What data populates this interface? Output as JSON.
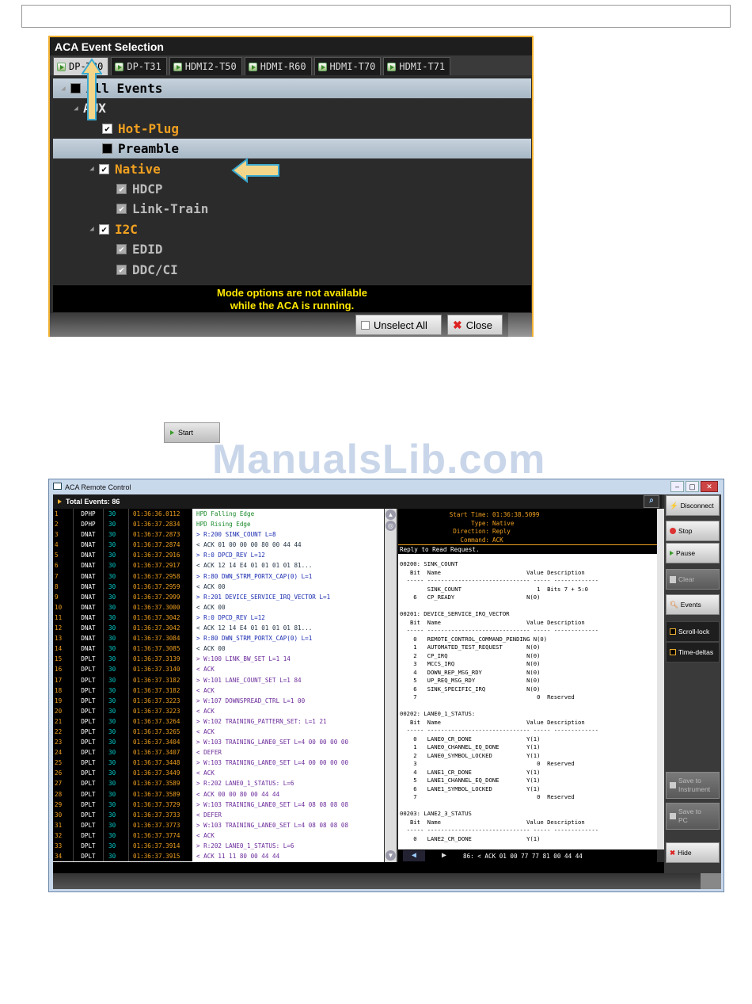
{
  "event_selection": {
    "title": "ACA Event Selection",
    "tabs": [
      "DP-T30",
      "DP-T31",
      "HDMI2-T50",
      "HDMI-R60",
      "HDMI-T70",
      "HDMI-T71"
    ],
    "selected_tab": "DP-T30",
    "tree": [
      {
        "label": "All Events",
        "check": "none",
        "style": "white",
        "highlight": true
      },
      {
        "label": "AUX",
        "check": "",
        "style": "white"
      },
      {
        "label": "Hot-Plug",
        "check": "checked",
        "style": "orange"
      },
      {
        "label": "Preamble",
        "check": "black",
        "style": "dark",
        "highlight": true
      },
      {
        "label": "Native",
        "check": "checked",
        "style": "orange"
      },
      {
        "label": "HDCP",
        "check": "grey",
        "style": "grey"
      },
      {
        "label": "Link-Train",
        "check": "grey",
        "style": "grey"
      },
      {
        "label": "I2C",
        "check": "checked",
        "style": "orange"
      },
      {
        "label": "EDID",
        "check": "grey",
        "style": "grey"
      },
      {
        "label": "DDC/CI",
        "check": "grey",
        "style": "grey"
      }
    ],
    "message_line1": "Mode options are not available",
    "message_line2": "while the ACA is running.",
    "unselect_all_label": "Unselect All",
    "close_label": "Close",
    "accent_color": "#f0b030"
  },
  "start_button": {
    "label": "Start"
  },
  "watermark": "ManualsLib.com",
  "remote_control": {
    "title": "ACA Remote Control",
    "total_events": "Total Events: 86",
    "log": [
      [
        "1",
        "DPHP",
        "30",
        "01:36:36.0112",
        "HPD Falling Edge",
        "green"
      ],
      [
        "2",
        "DPHP",
        "30",
        "01:36:37.2834",
        "HPD Rising Edge",
        "green"
      ],
      [
        "3",
        "DNAT",
        "30",
        "01:36:37.2873",
        "> R:200 SINK_COUNT L=8",
        "blue"
      ],
      [
        "4",
        "DNAT",
        "30",
        "01:36:37.2874",
        "< ACK 01 00 00 00 80 00 44 44",
        "navy"
      ],
      [
        "5",
        "DNAT",
        "30",
        "01:36:37.2916",
        "> R:0 DPCD_REV L=12",
        "blue"
      ],
      [
        "6",
        "DNAT",
        "30",
        "01:36:37.2917",
        "< ACK 12 14 E4 01 01 01 01 81...",
        "navy"
      ],
      [
        "7",
        "DNAT",
        "30",
        "01:36:37.2958",
        "> R:80 DWN_STRM_PORTX_CAP(0) L=1",
        "blue"
      ],
      [
        "8",
        "DNAT",
        "30",
        "01:36:37.2959",
        "< ACK 00",
        "navy"
      ],
      [
        "9",
        "DNAT",
        "30",
        "01:36:37.2999",
        "> R:201 DEVICE_SERVICE_IRQ_VECTOR L=1",
        "blue"
      ],
      [
        "10",
        "DNAT",
        "30",
        "01:36:37.3000",
        "< ACK 00",
        "navy"
      ],
      [
        "11",
        "DNAT",
        "30",
        "01:36:37.3042",
        "> R:0 DPCD_REV L=12",
        "blue"
      ],
      [
        "12",
        "DNAT",
        "30",
        "01:36:37.3042",
        "< ACK 12 14 E4 01 01 01 01 81...",
        "navy"
      ],
      [
        "13",
        "DNAT",
        "30",
        "01:36:37.3084",
        "> R:80 DWN_STRM_PORTX_CAP(0) L=1",
        "blue"
      ],
      [
        "14",
        "DNAT",
        "30",
        "01:36:37.3085",
        "< ACK 00",
        "navy"
      ],
      [
        "15",
        "DPLT",
        "30",
        "01:36:37.3139",
        "> W:100 LINK_BW_SET L=1 14",
        "purple"
      ],
      [
        "16",
        "DPLT",
        "30",
        "01:36:37.3140",
        "< ACK",
        "purple"
      ],
      [
        "17",
        "DPLT",
        "30",
        "01:36:37.3182",
        "> W:101 LANE_COUNT_SET L=1 84",
        "purple"
      ],
      [
        "18",
        "DPLT",
        "30",
        "01:36:37.3182",
        "< ACK",
        "purple"
      ],
      [
        "19",
        "DPLT",
        "30",
        "01:36:37.3223",
        "> W:107 DOWNSPREAD_CTRL L=1 00",
        "purple"
      ],
      [
        "20",
        "DPLT",
        "30",
        "01:36:37.3223",
        "< ACK",
        "purple"
      ],
      [
        "21",
        "DPLT",
        "30",
        "01:36:37.3264",
        "> W:102 TRAINING_PATTERN_SET: L=1 21",
        "purple"
      ],
      [
        "22",
        "DPLT",
        "30",
        "01:36:37.3265",
        "< ACK",
        "purple"
      ],
      [
        "23",
        "DPLT",
        "30",
        "01:36:37.3404",
        "> W:103 TRAINING_LANE0_SET L=4 00 00 00 00",
        "purple"
      ],
      [
        "24",
        "DPLT",
        "30",
        "01:36:37.3407",
        "< DEFER",
        "purple"
      ],
      [
        "25",
        "DPLT",
        "30",
        "01:36:37.3448",
        "> W:103 TRAINING_LANE0_SET L=4 00 00 00 00",
        "purple"
      ],
      [
        "26",
        "DPLT",
        "30",
        "01:36:37.3449",
        "< ACK",
        "purple"
      ],
      [
        "27",
        "DPLT",
        "30",
        "01:36:37.3589",
        "> R:202 LANE0_1_STATUS: L=6",
        "purple"
      ],
      [
        "28",
        "DPLT",
        "30",
        "01:36:37.3589",
        "< ACK 00 00 80 00 44 44",
        "purple"
      ],
      [
        "29",
        "DPLT",
        "30",
        "01:36:37.3729",
        "> W:103 TRAINING_LANE0_SET L=4 08 08 08 08",
        "purple"
      ],
      [
        "30",
        "DPLT",
        "30",
        "01:36:37.3733",
        "< DEFER",
        "purple"
      ],
      [
        "31",
        "DPLT",
        "30",
        "01:36:37.3773",
        "> W:103 TRAINING_LANE0_SET L=4 08 08 08 08",
        "purple"
      ],
      [
        "32",
        "DPLT",
        "30",
        "01:36:37.3774",
        "< ACK",
        "purple"
      ],
      [
        "33",
        "DPLT",
        "30",
        "01:36:37.3914",
        "> R:202 LANE0_1_STATUS: L=6",
        "purple"
      ],
      [
        "34",
        "DPLT",
        "30",
        "01:36:37.3915",
        "< ACK 11 11 80 00 44 44",
        "purple"
      ]
    ],
    "detail": {
      "start_time_label": "Start Time:",
      "start_time": "01:36:38.5099",
      "type_label": "Type:",
      "type": "Native",
      "direction_label": "Direction:",
      "direction": "Reply",
      "command_label": "Command:",
      "command": "ACK",
      "reply_title": "Reply to Read Request.",
      "body": "00200: SINK_COUNT\n   Bit  Name                         Value Description\n  ----- ------------------------------ ----- -------------\n        SINK_COUNT                      1  Bits 7 + 5:0\n    6   CP_READY                     N(0)\n\n00201: DEVICE_SERVICE_IRQ_VECTOR\n   Bit  Name                         Value Description\n  ----- ------------------------------ ----- -------------\n    0   REMOTE_CONTROL_COMMAND_PENDING N(0)\n    1   AUTOMATED_TEST_REQUEST       N(0)\n    2   CP_IRQ                       N(0)\n    3   MCCS_IRQ                     N(0)\n    4   DOWN_REP_MSG_RDY             N(0)\n    5   UP_REQ_MSG_RDY               N(0)\n    6   SINK_SPECIFIC_IRQ            N(0)\n    7                                   0  Reserved\n\n00202: LANE0_1_STATUS:\n   Bit  Name                         Value Description\n  ----- ------------------------------ ----- -------------\n    0   LANE0_CR_DONE                Y(1)\n    1   LANE0_CHANNEL_EQ_DONE        Y(1)\n    2   LANE0_SYMBOL_LOCKED          Y(1)\n    3                                   0  Reserved\n    4   LANE1_CR_DONE                Y(1)\n    5   LANE1_CHANNEL_EQ_DONE        Y(1)\n    6   LANE1_SYMBOL_LOCKED          Y(1)\n    7                                   0  Reserved\n\n00203: LANE2_3_STATUS\n   Bit  Name                         Value Description\n  ----- ------------------------------ ----- -------------\n    0   LANE2_CR_DONE                Y(1)",
      "nav_text": "86: < ACK 01 00 77 77 81 00 44 44"
    },
    "side_buttons": {
      "disconnect": "Disconnect",
      "stop": "Stop",
      "pause": "Pause",
      "clear": "Clear",
      "events": "Events",
      "scroll_lock": "Scroll-lock",
      "time_deltas": "Time-deltas",
      "save_instrument_1": "Save to",
      "save_instrument_2": "Instrument",
      "save_pc_1": "Save to",
      "save_pc_2": "PC",
      "hide": "Hide"
    }
  }
}
